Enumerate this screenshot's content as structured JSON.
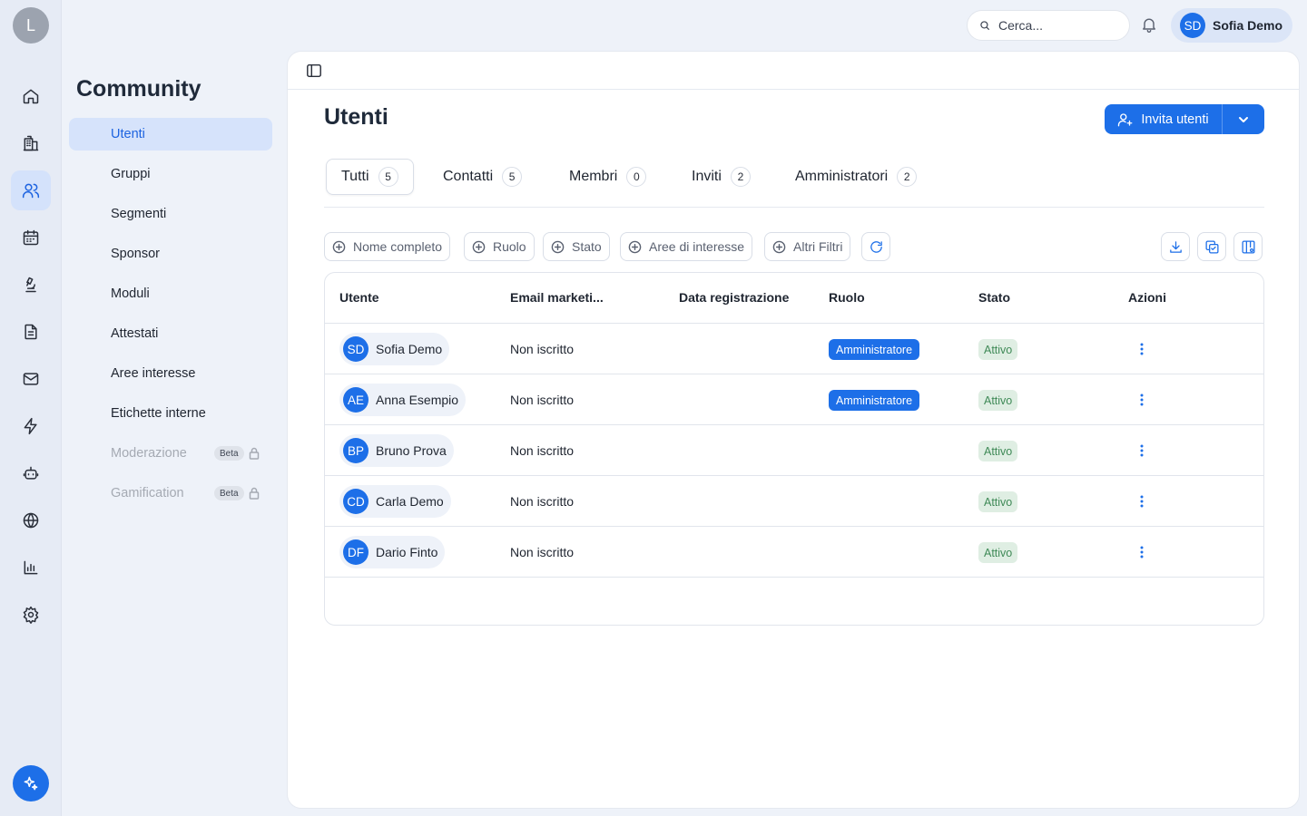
{
  "rail": {
    "avatar_initial": "L",
    "items": [
      {
        "icon": "home-icon"
      },
      {
        "icon": "building-icon"
      },
      {
        "icon": "users-icon",
        "active": true
      },
      {
        "icon": "calendar-icon"
      },
      {
        "icon": "microscope-icon"
      },
      {
        "icon": "document-icon"
      },
      {
        "icon": "mail-icon"
      },
      {
        "icon": "lightning-icon"
      },
      {
        "icon": "bot-icon"
      },
      {
        "icon": "globe-icon"
      },
      {
        "icon": "bar-chart-icon"
      },
      {
        "icon": "gear-icon"
      }
    ],
    "ai_icon": "sparkles-icon"
  },
  "subnav": {
    "title": "Community",
    "items": [
      {
        "label": "Utenti",
        "active": true
      },
      {
        "label": "Gruppi"
      },
      {
        "label": "Segmenti"
      },
      {
        "label": "Sponsor"
      },
      {
        "label": "Moduli"
      },
      {
        "label": "Attestati"
      },
      {
        "label": "Aree interesse"
      },
      {
        "label": "Etichette interne"
      },
      {
        "label": "Moderazione",
        "badge": "Beta",
        "locked": true
      },
      {
        "label": "Gamification",
        "badge": "Beta",
        "locked": true
      }
    ]
  },
  "topbar": {
    "search_placeholder": "Cerca...",
    "user_initials": "SD",
    "user_name": "Sofia Demo"
  },
  "page": {
    "title": "Utenti",
    "invite_label": "Invita utenti"
  },
  "tabs": [
    {
      "label": "Tutti",
      "count": "5",
      "active": true
    },
    {
      "label": "Contatti",
      "count": "5"
    },
    {
      "label": "Membri",
      "count": "0"
    },
    {
      "label": "Inviti",
      "count": "2"
    },
    {
      "label": "Amministratori",
      "count": "2"
    }
  ],
  "filters": [
    "Nome completo",
    "Ruolo",
    "Stato",
    "Aree di interesse",
    "Altri Filtri"
  ],
  "table": {
    "columns": [
      "Utente",
      "Email marketi...",
      "Data registrazione",
      "Ruolo",
      "Stato",
      "Azioni"
    ],
    "rows": [
      {
        "initials": "SD",
        "name": "Sofia Demo",
        "email": "Non iscritto",
        "date": "",
        "role": "Amministratore",
        "status": "Attivo"
      },
      {
        "initials": "AE",
        "name": "Anna Esempio",
        "email": "Non iscritto",
        "date": "",
        "role": "Amministratore",
        "status": "Attivo"
      },
      {
        "initials": "BP",
        "name": "Bruno Prova",
        "email": "Non iscritto",
        "date": "",
        "role": "",
        "status": "Attivo"
      },
      {
        "initials": "CD",
        "name": "Carla Demo",
        "email": "Non iscritto",
        "date": "",
        "role": "",
        "status": "Attivo"
      },
      {
        "initials": "DF",
        "name": "Dario Finto",
        "email": "Non iscritto",
        "date": "",
        "role": "",
        "status": "Attivo"
      }
    ]
  },
  "colors": {
    "accent": "#1d6fe8",
    "status_bg": "#dfeee3",
    "status_text": "#3f8a57"
  }
}
